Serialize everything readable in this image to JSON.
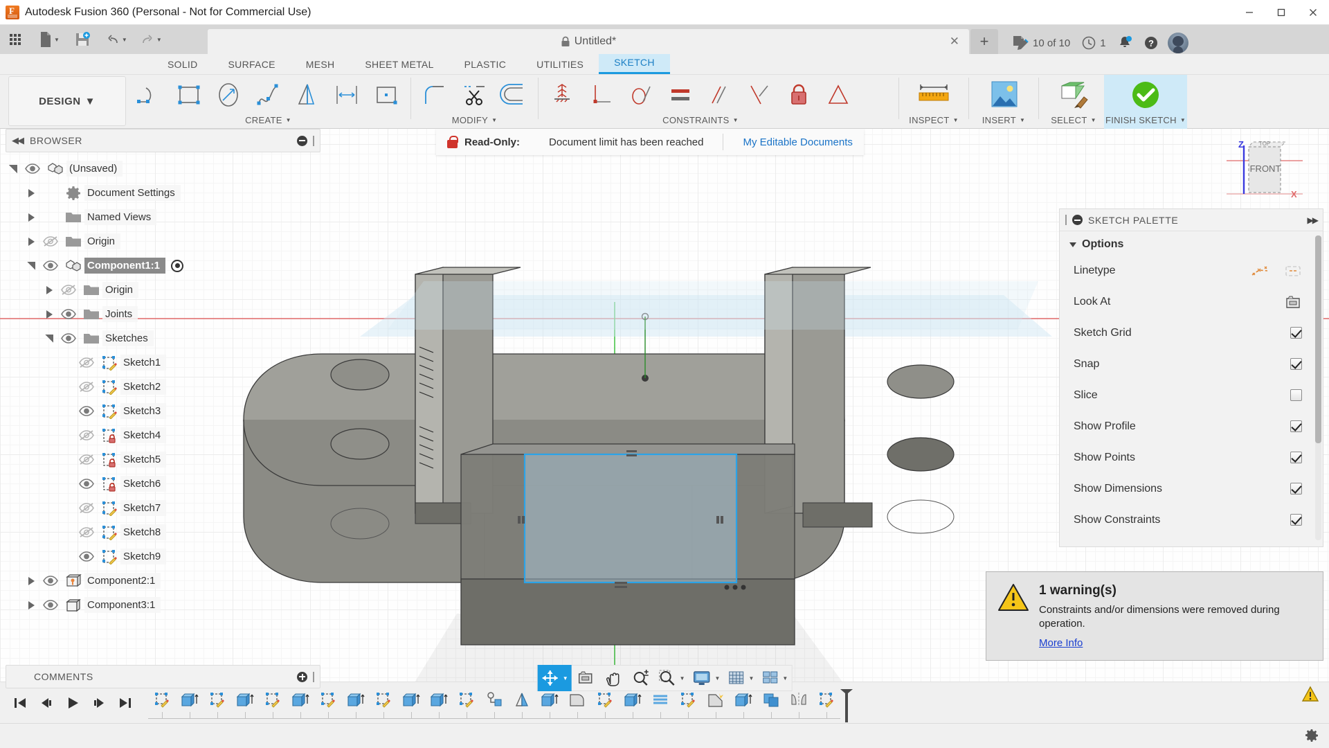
{
  "window": {
    "title": "Autodesk Fusion 360 (Personal - Not for Commercial Use)",
    "minimize_label": "─",
    "maximize_label": "❐",
    "close_label": "✕"
  },
  "quick_access": {
    "grid_label": "",
    "new_label": "",
    "save_label": "",
    "undo_label": "",
    "redo_label": "",
    "doc_tab": {
      "title": "Untitled*",
      "close_label": "✕",
      "new_tab_label": "+"
    },
    "editable_docs_count": "10 of 10",
    "recent_count": "1"
  },
  "ribbon": {
    "workspace_label": "DESIGN",
    "tabs": [
      {
        "label": "SOLID",
        "active": false
      },
      {
        "label": "SURFACE",
        "active": false
      },
      {
        "label": "MESH",
        "active": false
      },
      {
        "label": "SHEET METAL",
        "active": false
      },
      {
        "label": "PLASTIC",
        "active": false
      },
      {
        "label": "UTILITIES",
        "active": false
      },
      {
        "label": "SKETCH",
        "active": true
      }
    ],
    "groups": [
      {
        "label": "CREATE",
        "dropdown": true
      },
      {
        "label": "MODIFY",
        "dropdown": true
      },
      {
        "label": "CONSTRAINTS",
        "dropdown": true
      },
      {
        "label": "INSPECT",
        "dropdown": true
      },
      {
        "label": "INSERT",
        "dropdown": true
      },
      {
        "label": "SELECT",
        "dropdown": true
      },
      {
        "label": "FINISH SKETCH",
        "dropdown": true
      }
    ]
  },
  "browser": {
    "title": "BROWSER",
    "collapse_label": "◀◀",
    "tree": [
      {
        "label": "(Unsaved)",
        "indent": 0,
        "expander": "open",
        "eye": "visible",
        "icon": "component-icon",
        "selected": false
      },
      {
        "label": "Document Settings",
        "indent": 1,
        "expander": "closed",
        "eye": "none",
        "icon": "gear-icon",
        "selected": false
      },
      {
        "label": "Named Views",
        "indent": 1,
        "expander": "closed",
        "eye": "none",
        "icon": "folder-icon",
        "selected": false
      },
      {
        "label": "Origin",
        "indent": 1,
        "expander": "closed",
        "eye": "hidden",
        "icon": "folder-icon",
        "selected": false
      },
      {
        "label": "Component1:1",
        "indent": 1,
        "expander": "open",
        "eye": "visible",
        "icon": "component-icon",
        "selected": true,
        "activated": true
      },
      {
        "label": "Origin",
        "indent": 2,
        "expander": "closed",
        "eye": "hidden",
        "icon": "folder-icon",
        "selected": false
      },
      {
        "label": "Joints",
        "indent": 2,
        "expander": "closed",
        "eye": "visible",
        "icon": "folder-icon",
        "selected": false
      },
      {
        "label": "Sketches",
        "indent": 2,
        "expander": "open",
        "eye": "visible",
        "icon": "folder-icon",
        "selected": false
      },
      {
        "label": "Sketch1",
        "indent": 3,
        "expander": "none",
        "eye": "hidden",
        "icon": "sketch-icon",
        "selected": false
      },
      {
        "label": "Sketch2",
        "indent": 3,
        "expander": "none",
        "eye": "hidden",
        "icon": "sketch-icon",
        "selected": false
      },
      {
        "label": "Sketch3",
        "indent": 3,
        "expander": "none",
        "eye": "visible",
        "icon": "sketch-icon",
        "selected": false
      },
      {
        "label": "Sketch4",
        "indent": 3,
        "expander": "none",
        "eye": "hidden",
        "icon": "sketch-locked-icon",
        "selected": false
      },
      {
        "label": "Sketch5",
        "indent": 3,
        "expander": "none",
        "eye": "hidden",
        "icon": "sketch-locked-icon",
        "selected": false
      },
      {
        "label": "Sketch6",
        "indent": 3,
        "expander": "none",
        "eye": "visible",
        "icon": "sketch-locked-icon",
        "selected": false
      },
      {
        "label": "Sketch7",
        "indent": 3,
        "expander": "none",
        "eye": "hidden",
        "icon": "sketch-icon",
        "selected": false
      },
      {
        "label": "Sketch8",
        "indent": 3,
        "expander": "none",
        "eye": "hidden",
        "icon": "sketch-icon",
        "selected": false
      },
      {
        "label": "Sketch9",
        "indent": 3,
        "expander": "none",
        "eye": "visible",
        "icon": "sketch-icon",
        "selected": false
      },
      {
        "label": "Component2:1",
        "indent": 1,
        "expander": "closed",
        "eye": "visible",
        "icon": "component-pin-icon",
        "selected": false
      },
      {
        "label": "Component3:1",
        "indent": 1,
        "expander": "closed",
        "eye": "visible",
        "icon": "body-icon",
        "selected": false
      }
    ]
  },
  "comments": {
    "title": "COMMENTS"
  },
  "readonly_banner": {
    "label": "Read-Only:",
    "message": "Document limit has been reached",
    "link": "My Editable Documents"
  },
  "sketch_palette": {
    "title": "SKETCH PALETTE",
    "expand_label": "▶▶",
    "section": "Options",
    "rows": [
      {
        "label": "Linetype",
        "control": "linetype-buttons"
      },
      {
        "label": "Look At",
        "control": "lookat-button"
      },
      {
        "label": "Sketch Grid",
        "control": "checkbox",
        "checked": true
      },
      {
        "label": "Snap",
        "control": "checkbox",
        "checked": true
      },
      {
        "label": "Slice",
        "control": "checkbox",
        "checked": false
      },
      {
        "label": "Show Profile",
        "control": "checkbox",
        "checked": true
      },
      {
        "label": "Show Points",
        "control": "checkbox",
        "checked": true
      },
      {
        "label": "Show Dimensions",
        "control": "checkbox",
        "checked": true
      },
      {
        "label": "Show Constraints",
        "control": "checkbox",
        "checked": true
      }
    ]
  },
  "warning_toast": {
    "title": "1 warning(s)",
    "body": "Constraints and/or dimensions were removed during operation.",
    "link": "More Info"
  },
  "view_cube": {
    "top_label": "TOP",
    "front_label": "FRONT",
    "axis_z": "Z",
    "axis_x": "X"
  },
  "nav_bar": {
    "buttons": [
      {
        "name": "orbit-button",
        "label": "",
        "active": true,
        "dropdown": true
      },
      {
        "name": "look-at-button",
        "label": "",
        "active": false,
        "dropdown": false
      },
      {
        "name": "pan-button",
        "label": "",
        "active": false,
        "dropdown": false
      },
      {
        "name": "zoom-button",
        "label": "",
        "active": false,
        "dropdown": false
      },
      {
        "name": "zoom-window-button",
        "label": "",
        "active": false,
        "dropdown": true
      },
      {
        "name": "display-settings-button",
        "label": "",
        "active": false,
        "dropdown": true
      },
      {
        "name": "grid-snaps-button",
        "label": "",
        "active": false,
        "dropdown": true
      },
      {
        "name": "viewports-button",
        "label": "",
        "active": false,
        "dropdown": true
      }
    ]
  },
  "timeline": {
    "nav": [
      {
        "name": "go-to-beginning-button"
      },
      {
        "name": "step-back-button"
      },
      {
        "name": "play-button"
      },
      {
        "name": "step-forward-button"
      },
      {
        "name": "go-to-end-button"
      }
    ],
    "features": [
      "sketch",
      "extrude",
      "sketch",
      "extrude",
      "sketch",
      "extrude",
      "sketch",
      "extrude",
      "sketch",
      "extrude",
      "extrude",
      "sketch",
      "joint",
      "mirror",
      "extrude",
      "fillet",
      "sketch",
      "extrude",
      "thread",
      "sketch",
      "chamfer",
      "extrude",
      "combine",
      "mirror-body",
      "sketch"
    ]
  },
  "status_bar": {
    "settings_label": ""
  },
  "canvas": {
    "active_sketch_profile": "rectangle-profile"
  }
}
